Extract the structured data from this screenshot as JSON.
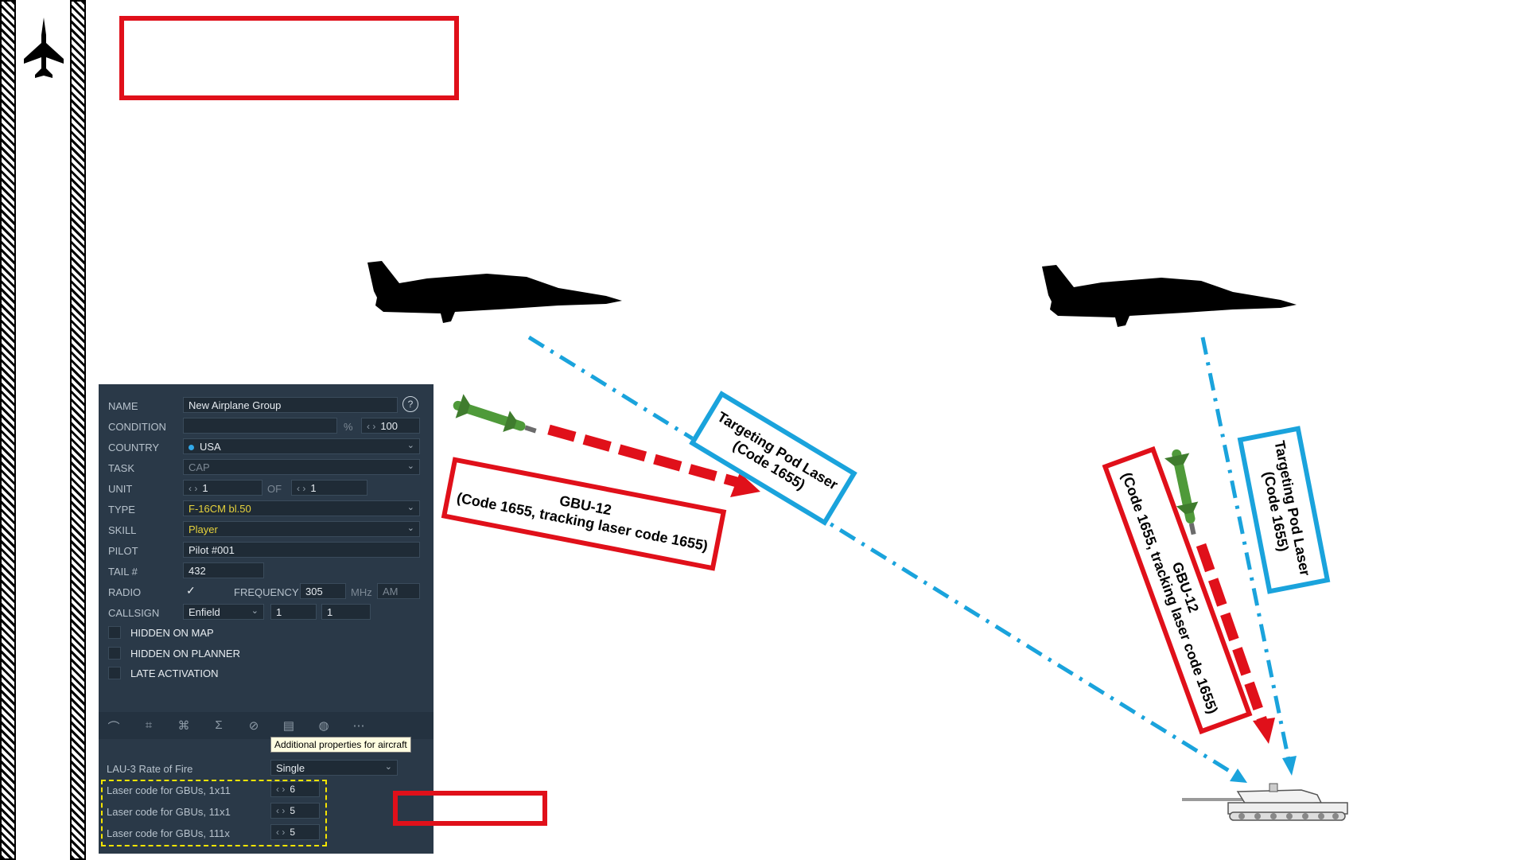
{
  "colors": {
    "red_annotation": "#e0101a",
    "blue_annotation": "#1aa3dc",
    "yellow_callout": "#f5e400",
    "panel_bg": "#2a3948"
  },
  "annotations": {
    "gbu_left": {
      "line1": "GBU-12",
      "line2": "(Code 1655, tracking laser code 1655)"
    },
    "gbu_right": {
      "line1": "GBU-12",
      "line2": "(Code 1655, tracking laser code 1655)"
    },
    "pod_left": {
      "line1": "Targeting Pod Laser",
      "line2": "(Code 1655)"
    },
    "pod_right": {
      "line1": "Targeting Pod Laser",
      "line2": "(Code 1655)"
    }
  },
  "panel": {
    "name": {
      "label": "NAME",
      "value": "New Airplane Group",
      "help": "?"
    },
    "condition": {
      "label": "CONDITION",
      "percent": "%",
      "value": "100"
    },
    "country": {
      "label": "COUNTRY",
      "value": "USA"
    },
    "task": {
      "label": "TASK",
      "value": "CAP"
    },
    "unit": {
      "label": "UNIT",
      "value": "1",
      "of_label": "OF",
      "of_value": "1"
    },
    "type": {
      "label": "TYPE",
      "value": "F-16CM bl.50"
    },
    "skill": {
      "label": "SKILL",
      "value": "Player"
    },
    "pilot": {
      "label": "PILOT",
      "value": "Pilot #001"
    },
    "tail": {
      "label": "TAIL #",
      "value": "432"
    },
    "radio": {
      "label": "RADIO",
      "checked": true,
      "frequency_label": "FREQUENCY",
      "frequency": "305",
      "unit": "MHz",
      "modulation": "AM"
    },
    "callsign": {
      "label": "CALLSIGN",
      "value": "Enfield",
      "num1": "1",
      "num2": "1"
    },
    "checkboxes": [
      "HIDDEN ON MAP",
      "HIDDEN ON PLANNER",
      "LATE ACTIVATION"
    ],
    "tooltip": "Additional properties for aircraft",
    "properties": {
      "rate_label": "LAU-3 Rate of Fire",
      "rate_value": "Single",
      "codes": [
        {
          "label": "Laser code for GBUs, 1x11",
          "value": "6"
        },
        {
          "label": "Laser code for GBUs, 11x1",
          "value": "5"
        },
        {
          "label": "Laser code for GBUs, 111x",
          "value": "5"
        }
      ]
    }
  },
  "icons": [
    "jet-silhouette-icon",
    "gbu-12-bomb-icon",
    "tank-icon",
    "waypoint-icon",
    "triggers-icon",
    "payload-icon",
    "summary-icon",
    "failures-icon",
    "advanced-icon",
    "radio-icon",
    "more-icon",
    "help-icon",
    "chevron-down-icon",
    "check-icon"
  ]
}
